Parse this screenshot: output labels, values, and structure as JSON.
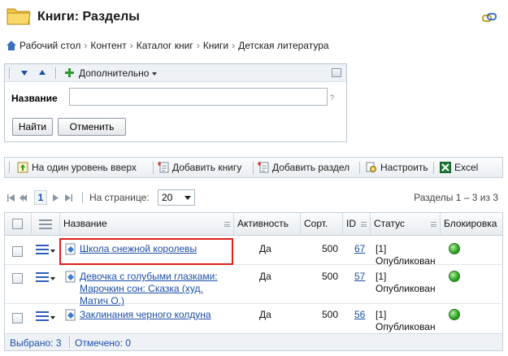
{
  "header": {
    "title": "Книги: Разделы"
  },
  "breadcrumb": [
    "Рабочий стол",
    "Контент",
    "Каталог книг",
    "Книги",
    "Детская литература"
  ],
  "filter": {
    "more_label": "Дополнительно",
    "name_label": "Название",
    "name_value": "",
    "help": "?",
    "find_label": "Найти",
    "cancel_label": "Отменить"
  },
  "toolbar": {
    "up_label": "На один уровень вверх",
    "add_book_label": "Добавить книгу",
    "add_section_label": "Добавить раздел",
    "settings_label": "Настроить",
    "excel_label": "Excel"
  },
  "pager": {
    "current_page": "1",
    "per_page_label": "На странице:",
    "per_page_value": "20",
    "summary": "Разделы 1 – 3 из 3"
  },
  "table": {
    "headers": {
      "name": "Название",
      "active": "Активность",
      "sort": "Сорт.",
      "id": "ID",
      "status": "Статус",
      "lock": "Блокировка"
    },
    "rows": [
      {
        "title": "Школа снежной королевы",
        "active": "Да",
        "sort": "500",
        "id": "67",
        "status": "[1] Опубликован"
      },
      {
        "title": "Девочка с голубыми глазками: Марочкин сон: Сказка (худ. Матич О.)",
        "active": "Да",
        "sort": "500",
        "id": "57",
        "status": "[1] Опубликован"
      },
      {
        "title": "Заклинания черного колдуна",
        "active": "Да",
        "sort": "500",
        "id": "56",
        "status": "[1] Опубликован"
      }
    ],
    "footer": {
      "selected": "Выбрано: 3",
      "checked": "Отмечено: 0"
    }
  },
  "colors": {
    "link": "#1c4fa8",
    "highlight": "#e0201c",
    "lamp": "#33a82a"
  }
}
